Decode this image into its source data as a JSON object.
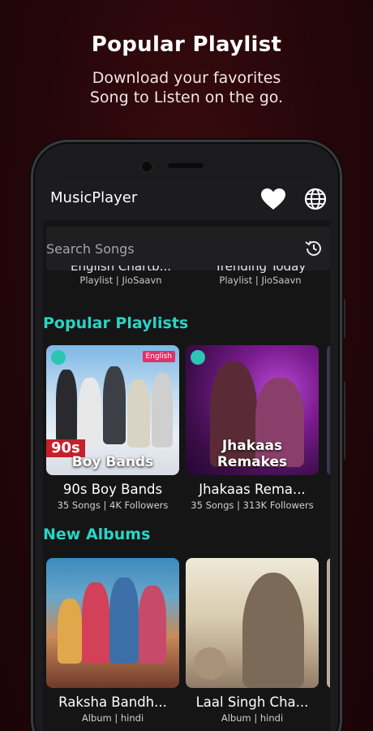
{
  "promo": {
    "title": "Popular Playlist",
    "subtitle_line1": "Download your favorites",
    "subtitle_line2": "Song to Listen on the go."
  },
  "appbar": {
    "title": "MusicPlayer"
  },
  "search": {
    "placeholder": "Search Songs",
    "value": ""
  },
  "charts": [
    {
      "title": "English Chartb...",
      "subtitle": "Playlist | JioSaavn"
    },
    {
      "title": "Trending Today",
      "subtitle": "Playlist | JioSaavn"
    }
  ],
  "popular": {
    "heading": "Popular Playlists",
    "items": [
      {
        "title": "90s Boy Bands",
        "subtitle": "35 Songs | 4K Followers",
        "badge": "English",
        "tag": "90s",
        "caption": "Boy Bands"
      },
      {
        "title": "Jhakaas Rema...",
        "subtitle": "35 Songs | 313K Followers",
        "caption": "Jhakaas Remakes"
      }
    ]
  },
  "albums": {
    "heading": "New Albums",
    "items": [
      {
        "title": "Raksha Bandh...",
        "subtitle": "Album | hindi"
      },
      {
        "title": "Laal Singh Cha...",
        "subtitle": "Album | hindi"
      }
    ]
  },
  "colors": {
    "accent": "#2ad4c5",
    "background": "#24060a",
    "screen": "#151516"
  }
}
